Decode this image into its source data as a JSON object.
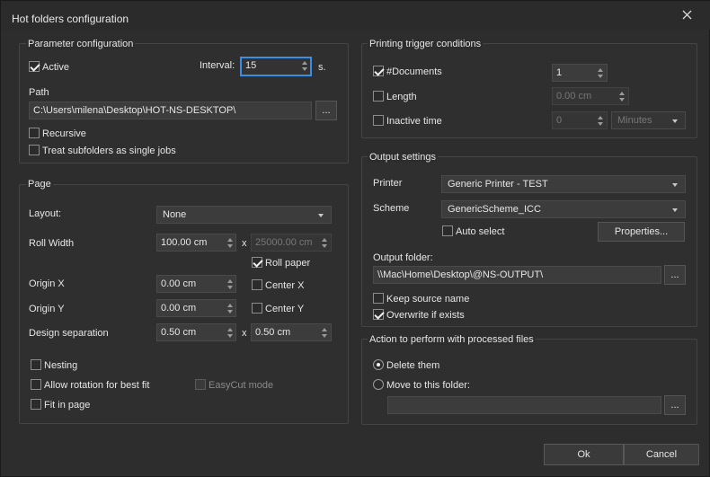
{
  "window": {
    "title": "Hot folders configuration"
  },
  "parameter_configuration": {
    "title": "Parameter configuration",
    "active_label": "Active",
    "active_checked": true,
    "interval_label": "Interval:",
    "interval_value": "15",
    "interval_unit": "s.",
    "path_label": "Path",
    "path_value": "C:\\Users\\milena\\Desktop\\HOT-NS-DESKTOP\\",
    "browse_label": "...",
    "recursive_label": "Recursive",
    "treat_subfolders_label": "Treat subfolders as single jobs"
  },
  "page": {
    "title": "Page",
    "layout_label": "Layout:",
    "layout_value": "None",
    "roll_width_label": "Roll Width",
    "roll_width_value": "100.00 cm",
    "x_sep": "x",
    "roll_length_value": "25000.00 cm",
    "roll_paper_label": "Roll paper",
    "origin_x_label": "Origin X",
    "origin_x_value": "0.00 cm",
    "center_x_label": "Center X",
    "origin_y_label": "Origin Y",
    "origin_y_value": "0.00 cm",
    "center_y_label": "Center Y",
    "design_sep_label": "Design separation",
    "design_sep_x_value": "0.50 cm",
    "design_sep_y_value": "0.50 cm",
    "nesting_label": "Nesting",
    "allow_rotation_label": "Allow rotation for best fit",
    "easycut_label": "EasyCut mode",
    "fit_page_label": "Fit in page"
  },
  "printing_trigger": {
    "title": "Printing trigger conditions",
    "documents_label": "#Documents",
    "documents_value": "1",
    "length_label": "Length",
    "length_value": "0.00 cm",
    "inactive_label": "Inactive time",
    "inactive_value": "0",
    "inactive_unit": "Minutes"
  },
  "output_settings": {
    "title": "Output settings",
    "printer_label": "Printer",
    "printer_value": "Generic Printer - TEST",
    "scheme_label": "Scheme",
    "scheme_value": "GenericScheme_ICC",
    "auto_select_label": "Auto select",
    "properties_label": "Properties...",
    "output_folder_label": "Output folder:",
    "output_folder_value": "\\\\Mac\\Home\\Desktop\\@NS-OUTPUT\\",
    "browse_label": "...",
    "keep_source_label": "Keep source name",
    "overwrite_label": "Overwrite if exists"
  },
  "action": {
    "title": "Action to perform with processed files",
    "delete_label": "Delete them",
    "move_label": "Move to this folder:",
    "move_folder_value": "",
    "browse_label": "..."
  },
  "buttons": {
    "ok": "Ok",
    "cancel": "Cancel"
  }
}
